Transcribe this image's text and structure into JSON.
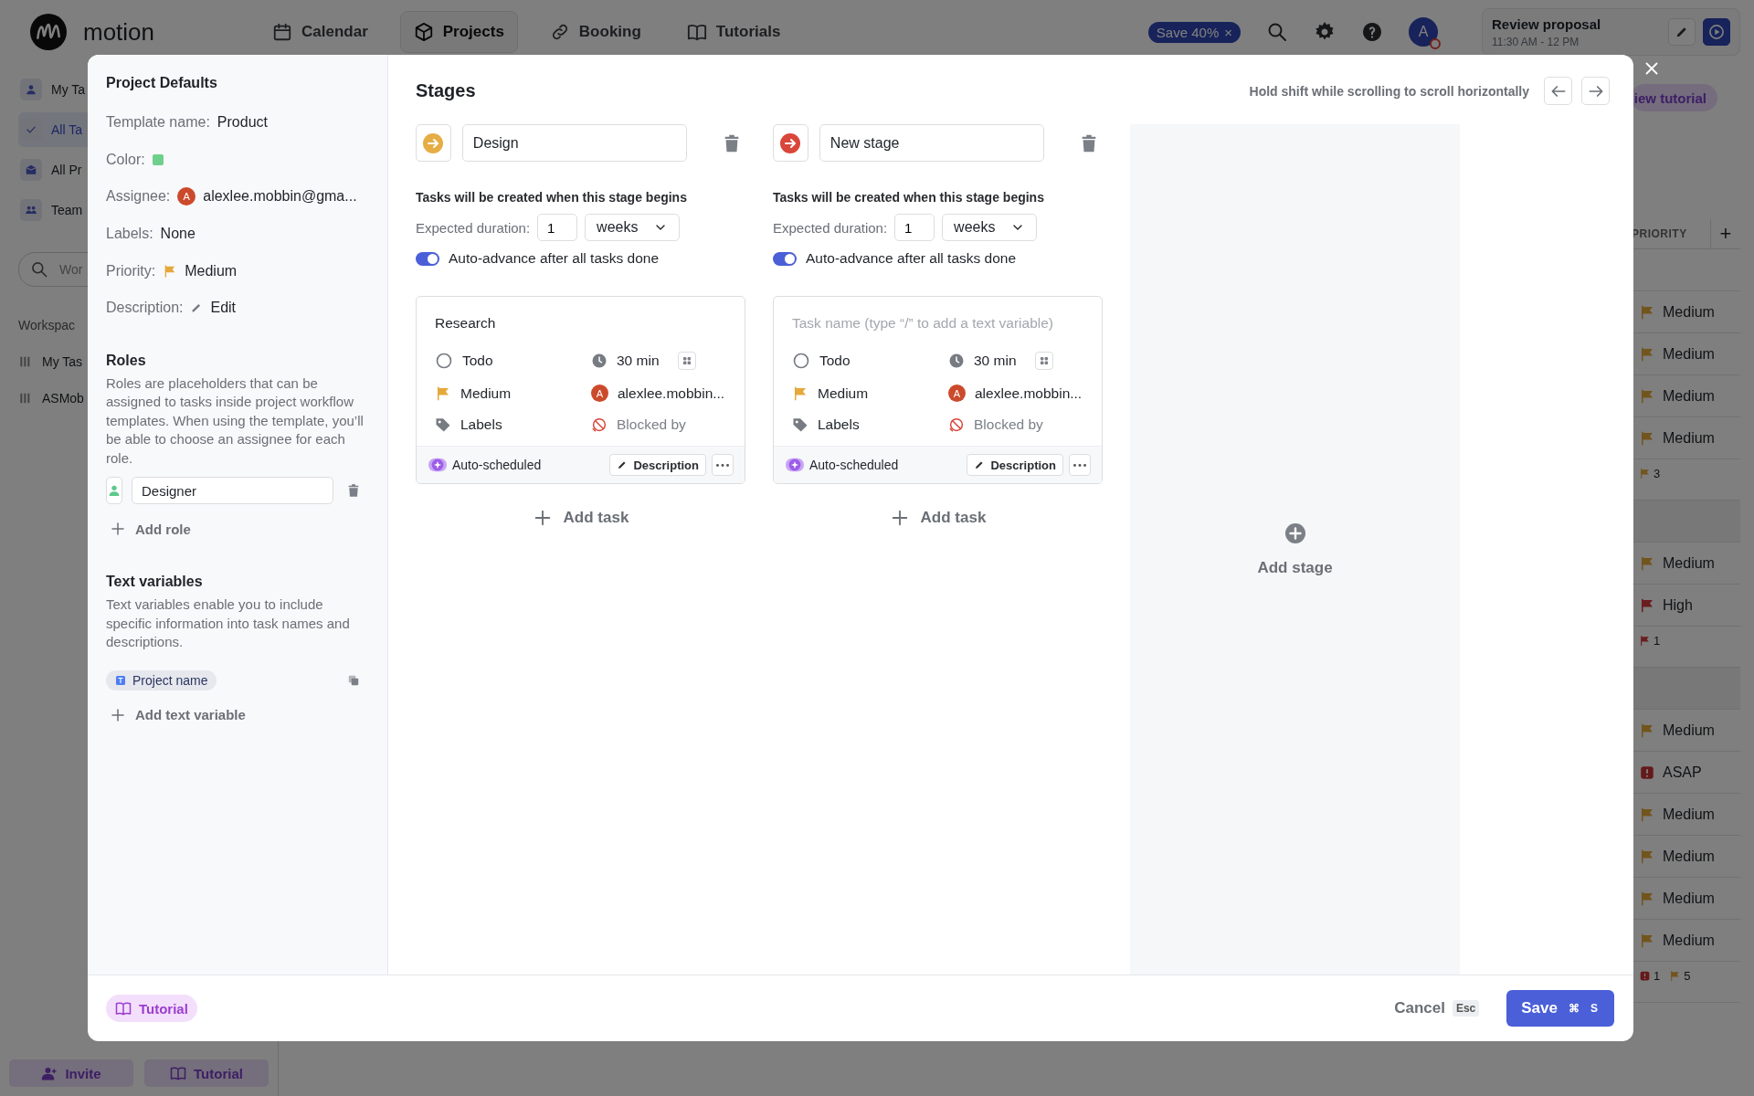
{
  "app": {
    "logo": "motion",
    "nav": [
      {
        "label": "Calendar",
        "kind": "calendar",
        "selected": false
      },
      {
        "label": "Projects",
        "kind": "projects",
        "selected": true
      },
      {
        "label": "Booking",
        "kind": "booking",
        "selected": false
      },
      {
        "label": "Tutorials",
        "kind": "tutorials",
        "selected": false
      }
    ],
    "promo": {
      "label": "Save 40%",
      "close": "×"
    },
    "avatar": {
      "initial": "A"
    },
    "event_card": {
      "title": "Review proposal",
      "time": "11:30 AM - 12 PM"
    },
    "sidebar": {
      "items": [
        {
          "label": "My Ta",
          "kind": "mine",
          "selected": false
        },
        {
          "label": "All Ta",
          "kind": "all",
          "selected": true
        },
        {
          "label": "All Pr",
          "kind": "projects",
          "selected": false
        },
        {
          "label": "Team",
          "kind": "team",
          "selected": false
        }
      ],
      "search": {
        "placeholder": "Wor"
      },
      "section": "Workspac",
      "workspaces": [
        "My Tas",
        "ASMob"
      ],
      "buttons": [
        {
          "label": "Invite",
          "kind": "invite"
        },
        {
          "label": "Tutorial",
          "kind": "tutorial"
        }
      ]
    },
    "view_tutorial": "iew tutorial",
    "table": {
      "columns": [
        "PRIORITY"
      ],
      "add": "+",
      "rows": [
        {
          "kind": "blank"
        },
        {
          "kind": "task",
          "flag": {
            "kind": "medium"
          },
          "label": "Medium"
        },
        {
          "kind": "task",
          "flag": {
            "kind": "medium"
          },
          "label": "Medium"
        },
        {
          "kind": "task",
          "flag": {
            "kind": "medium"
          },
          "label": "Medium"
        },
        {
          "kind": "task",
          "flag": {
            "kind": "medium"
          },
          "label": "Medium"
        },
        {
          "kind": "summary",
          "counts": [
            {
              "kind": "medium",
              "count": "3"
            }
          ]
        },
        {
          "kind": "group"
        },
        {
          "kind": "task",
          "flag": {
            "kind": "medium"
          },
          "label": "Medium"
        },
        {
          "kind": "task",
          "flag": {
            "kind": "high"
          },
          "label": "High"
        },
        {
          "kind": "summary",
          "counts": [
            {
              "kind": "high",
              "count": "1"
            }
          ]
        },
        {
          "kind": "group"
        },
        {
          "kind": "task",
          "flag": {
            "kind": "medium"
          },
          "label": "Medium"
        },
        {
          "kind": "task",
          "flag": {
            "kind": "asap"
          },
          "label": "ASAP"
        },
        {
          "kind": "task",
          "flag": {
            "kind": "medium"
          },
          "label": "Medium"
        },
        {
          "kind": "task",
          "flag": {
            "kind": "medium"
          },
          "label": "Medium"
        },
        {
          "kind": "task",
          "flag": {
            "kind": "medium"
          },
          "label": "Medium"
        },
        {
          "kind": "task",
          "flag": {
            "kind": "medium"
          },
          "label": "Medium"
        },
        {
          "kind": "summary",
          "counts": [
            {
              "kind": "asap",
              "count": "1"
            },
            {
              "kind": "medium",
              "count": "5"
            }
          ]
        }
      ]
    }
  },
  "modal": {
    "defaults": {
      "title": "Project Defaults",
      "fields": [
        {
          "kind": "text",
          "label": "Template name:",
          "value": "Product"
        },
        {
          "kind": "color",
          "label": "Color:",
          "color": "#6fd08c"
        },
        {
          "kind": "person",
          "label": "Assignee:",
          "initial": "A",
          "value": "alexlee.mobbin@gma..."
        },
        {
          "kind": "text",
          "label": "Labels:",
          "value": "None"
        },
        {
          "kind": "priority",
          "label": "Priority:",
          "flag": {
            "kind": "medium"
          },
          "value": "Medium"
        },
        {
          "kind": "edit",
          "label": "Description:",
          "value": "Edit"
        }
      ]
    },
    "roles": {
      "title": "Roles",
      "description": "Roles are placeholders that can be assigned to tasks inside project workflow templates. When using the template, you’ll be able to choose an assignee for each role.",
      "items": [
        {
          "value": "Designer"
        }
      ],
      "add": "Add role"
    },
    "text_variables": {
      "title": "Text variables",
      "description": "Text variables enable you to include specific information into task names and descriptions.",
      "items": [
        {
          "label": "Project name"
        }
      ],
      "add": "Add text variable"
    },
    "stages": {
      "title": "Stages",
      "hint": "Hold shift while scrolling to scroll horizontally",
      "columns": [
        {
          "color": "#e6ad45",
          "name": "Design",
          "note": "Tasks will be created when this stage begins",
          "duration_label": "Expected duration:",
          "duration": "1",
          "unit": "weeks",
          "auto_advance": {
            "label": "Auto-advance after all tasks done",
            "on": true
          },
          "tasks": [
            {
              "name": "Research",
              "status": "Todo",
              "duration": "30 min",
              "priority": {
                "kind": "medium",
                "label": "Medium"
              },
              "assignee_initial": "A",
              "assignee": "alexlee.mobbin...",
              "labels": "Labels",
              "blocked": "Blocked by",
              "schedule": "Auto-scheduled",
              "description": "Description"
            }
          ],
          "add_task": "Add task"
        },
        {
          "color": "#d9463a",
          "name": "New stage",
          "note": "Tasks will be created when this stage begins",
          "duration_label": "Expected duration:",
          "duration": "1",
          "unit": "weeks",
          "auto_advance": {
            "label": "Auto-advance after all tasks done",
            "on": true
          },
          "tasks": [
            {
              "placeholder": "Task name (type “/” to add a text variable)",
              "status": "Todo",
              "duration": "30 min",
              "priority": {
                "kind": "medium",
                "label": "Medium"
              },
              "assignee_initial": "A",
              "assignee": "alexlee.mobbin...",
              "labels": "Labels",
              "blocked": "Blocked by",
              "schedule": "Auto-scheduled",
              "description": "Description"
            }
          ],
          "add_task": "Add task"
        }
      ],
      "add_stage": "Add stage"
    },
    "footer": {
      "tutorial": "Tutorial",
      "cancel": "Cancel",
      "cancel_key": "Esc",
      "save": "Save",
      "save_keys": [
        "⌘",
        "S"
      ]
    }
  }
}
